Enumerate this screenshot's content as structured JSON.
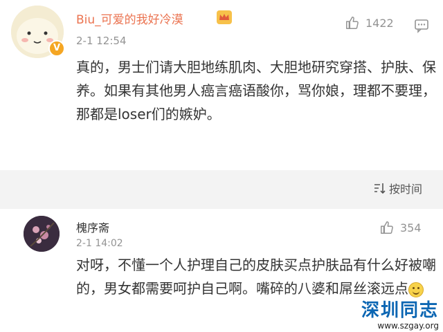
{
  "comments": [
    {
      "username": "Biu_可爱的我好冷漠",
      "time": "2-1 12:54",
      "likes": "1422",
      "text": "真的，男士们请大胆地练肌肉、大胆地研究穿搭、护肤、保养。如果有其他男人癌言癌语酸你，骂你娘，理都不要理，那都是loser们的嫉妒。",
      "avatar": "cartoon-face-avatar",
      "badge": "V"
    },
    {
      "username": "槐序斋",
      "time": "2-1 14:02",
      "likes": "354",
      "text": "对呀，不懂一个人护理自己的皮肤买点护肤品有什么好被嘲的，男女都需要呵护自己啊。嘴碎的八婆和屌丝滚远点",
      "avatar": "dark-flower-avatar",
      "emoji": "smile-emoji"
    }
  ],
  "sort": {
    "label": "按时间",
    "icon": "sort-icon"
  },
  "watermark": {
    "title": "深圳同志",
    "url": "www.szgay.org"
  },
  "colors": {
    "username_vip": "#eb7350",
    "meta_gray": "#939393",
    "divider_bg": "#f3f3f3",
    "watermark_blue": "#0b66b3"
  }
}
